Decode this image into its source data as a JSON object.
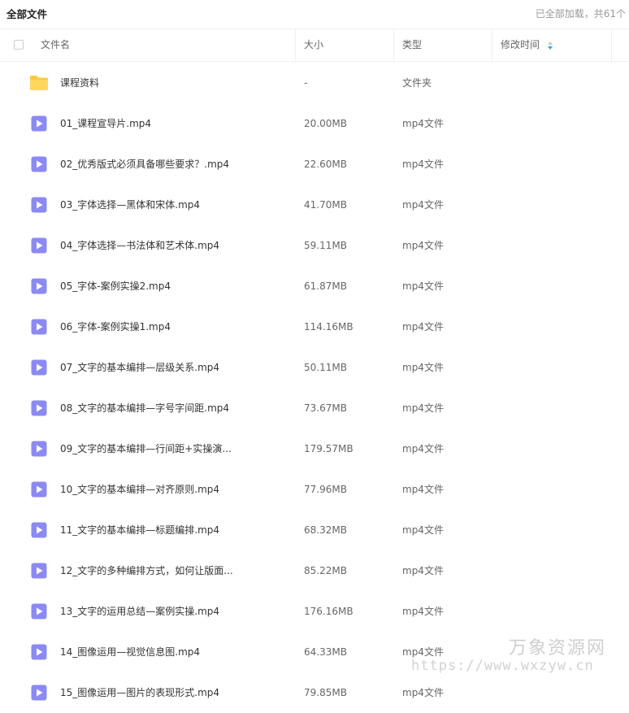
{
  "header": {
    "title": "全部文件",
    "loaded_status": "已全部加载，共61个"
  },
  "columns": {
    "name": "文件名",
    "size": "大小",
    "type": "类型",
    "modified": "修改时间"
  },
  "colors": {
    "folder": "#FFC940",
    "video_icon": "#8B8AF5",
    "sort_active": "#2DA7E0"
  },
  "files": [
    {
      "icon": "folder-icon",
      "name": "课程资料",
      "size": "-",
      "type": "文件夹"
    },
    {
      "icon": "video-file-icon",
      "name": "01_课程宣导片.mp4",
      "size": "20.00MB",
      "type": "mp4文件"
    },
    {
      "icon": "video-file-icon",
      "name": "02_优秀版式必须具备哪些要求？.mp4",
      "size": "22.60MB",
      "type": "mp4文件"
    },
    {
      "icon": "video-file-icon",
      "name": "03_字体选择—黑体和宋体.mp4",
      "size": "41.70MB",
      "type": "mp4文件"
    },
    {
      "icon": "video-file-icon",
      "name": "04_字体选择—书法体和艺术体.mp4",
      "size": "59.11MB",
      "type": "mp4文件"
    },
    {
      "icon": "video-file-icon",
      "name": "05_字体-案例实操2.mp4",
      "size": "61.87MB",
      "type": "mp4文件"
    },
    {
      "icon": "video-file-icon",
      "name": "06_字体-案例实操1.mp4",
      "size": "114.16MB",
      "type": "mp4文件"
    },
    {
      "icon": "video-file-icon",
      "name": "07_文字的基本编排—层级关系.mp4",
      "size": "50.11MB",
      "type": "mp4文件"
    },
    {
      "icon": "video-file-icon",
      "name": "08_文字的基本编排—字号字间距.mp4",
      "size": "73.67MB",
      "type": "mp4文件"
    },
    {
      "icon": "video-file-icon",
      "name": "09_文字的基本编排—行间距+实操演...",
      "size": "179.57MB",
      "type": "mp4文件"
    },
    {
      "icon": "video-file-icon",
      "name": "10_文字的基本编排—对齐原则.mp4",
      "size": "77.96MB",
      "type": "mp4文件"
    },
    {
      "icon": "video-file-icon",
      "name": "11_文字的基本编排—标题编排.mp4",
      "size": "68.32MB",
      "type": "mp4文件"
    },
    {
      "icon": "video-file-icon",
      "name": "12_文字的多种编排方式，如何让版面...",
      "size": "85.22MB",
      "type": "mp4文件"
    },
    {
      "icon": "video-file-icon",
      "name": "13_文字的运用总结—案例实操.mp4",
      "size": "176.16MB",
      "type": "mp4文件"
    },
    {
      "icon": "video-file-icon",
      "name": "14_图像运用—视觉信息图.mp4",
      "size": "64.33MB",
      "type": "mp4文件"
    },
    {
      "icon": "video-file-icon",
      "name": "15_图像运用—图片的表现形式.mp4",
      "size": "79.85MB",
      "type": "mp4文件"
    }
  ],
  "watermark": {
    "line1": "万象资源网",
    "line2": "https://www.wxzyw.cn"
  }
}
